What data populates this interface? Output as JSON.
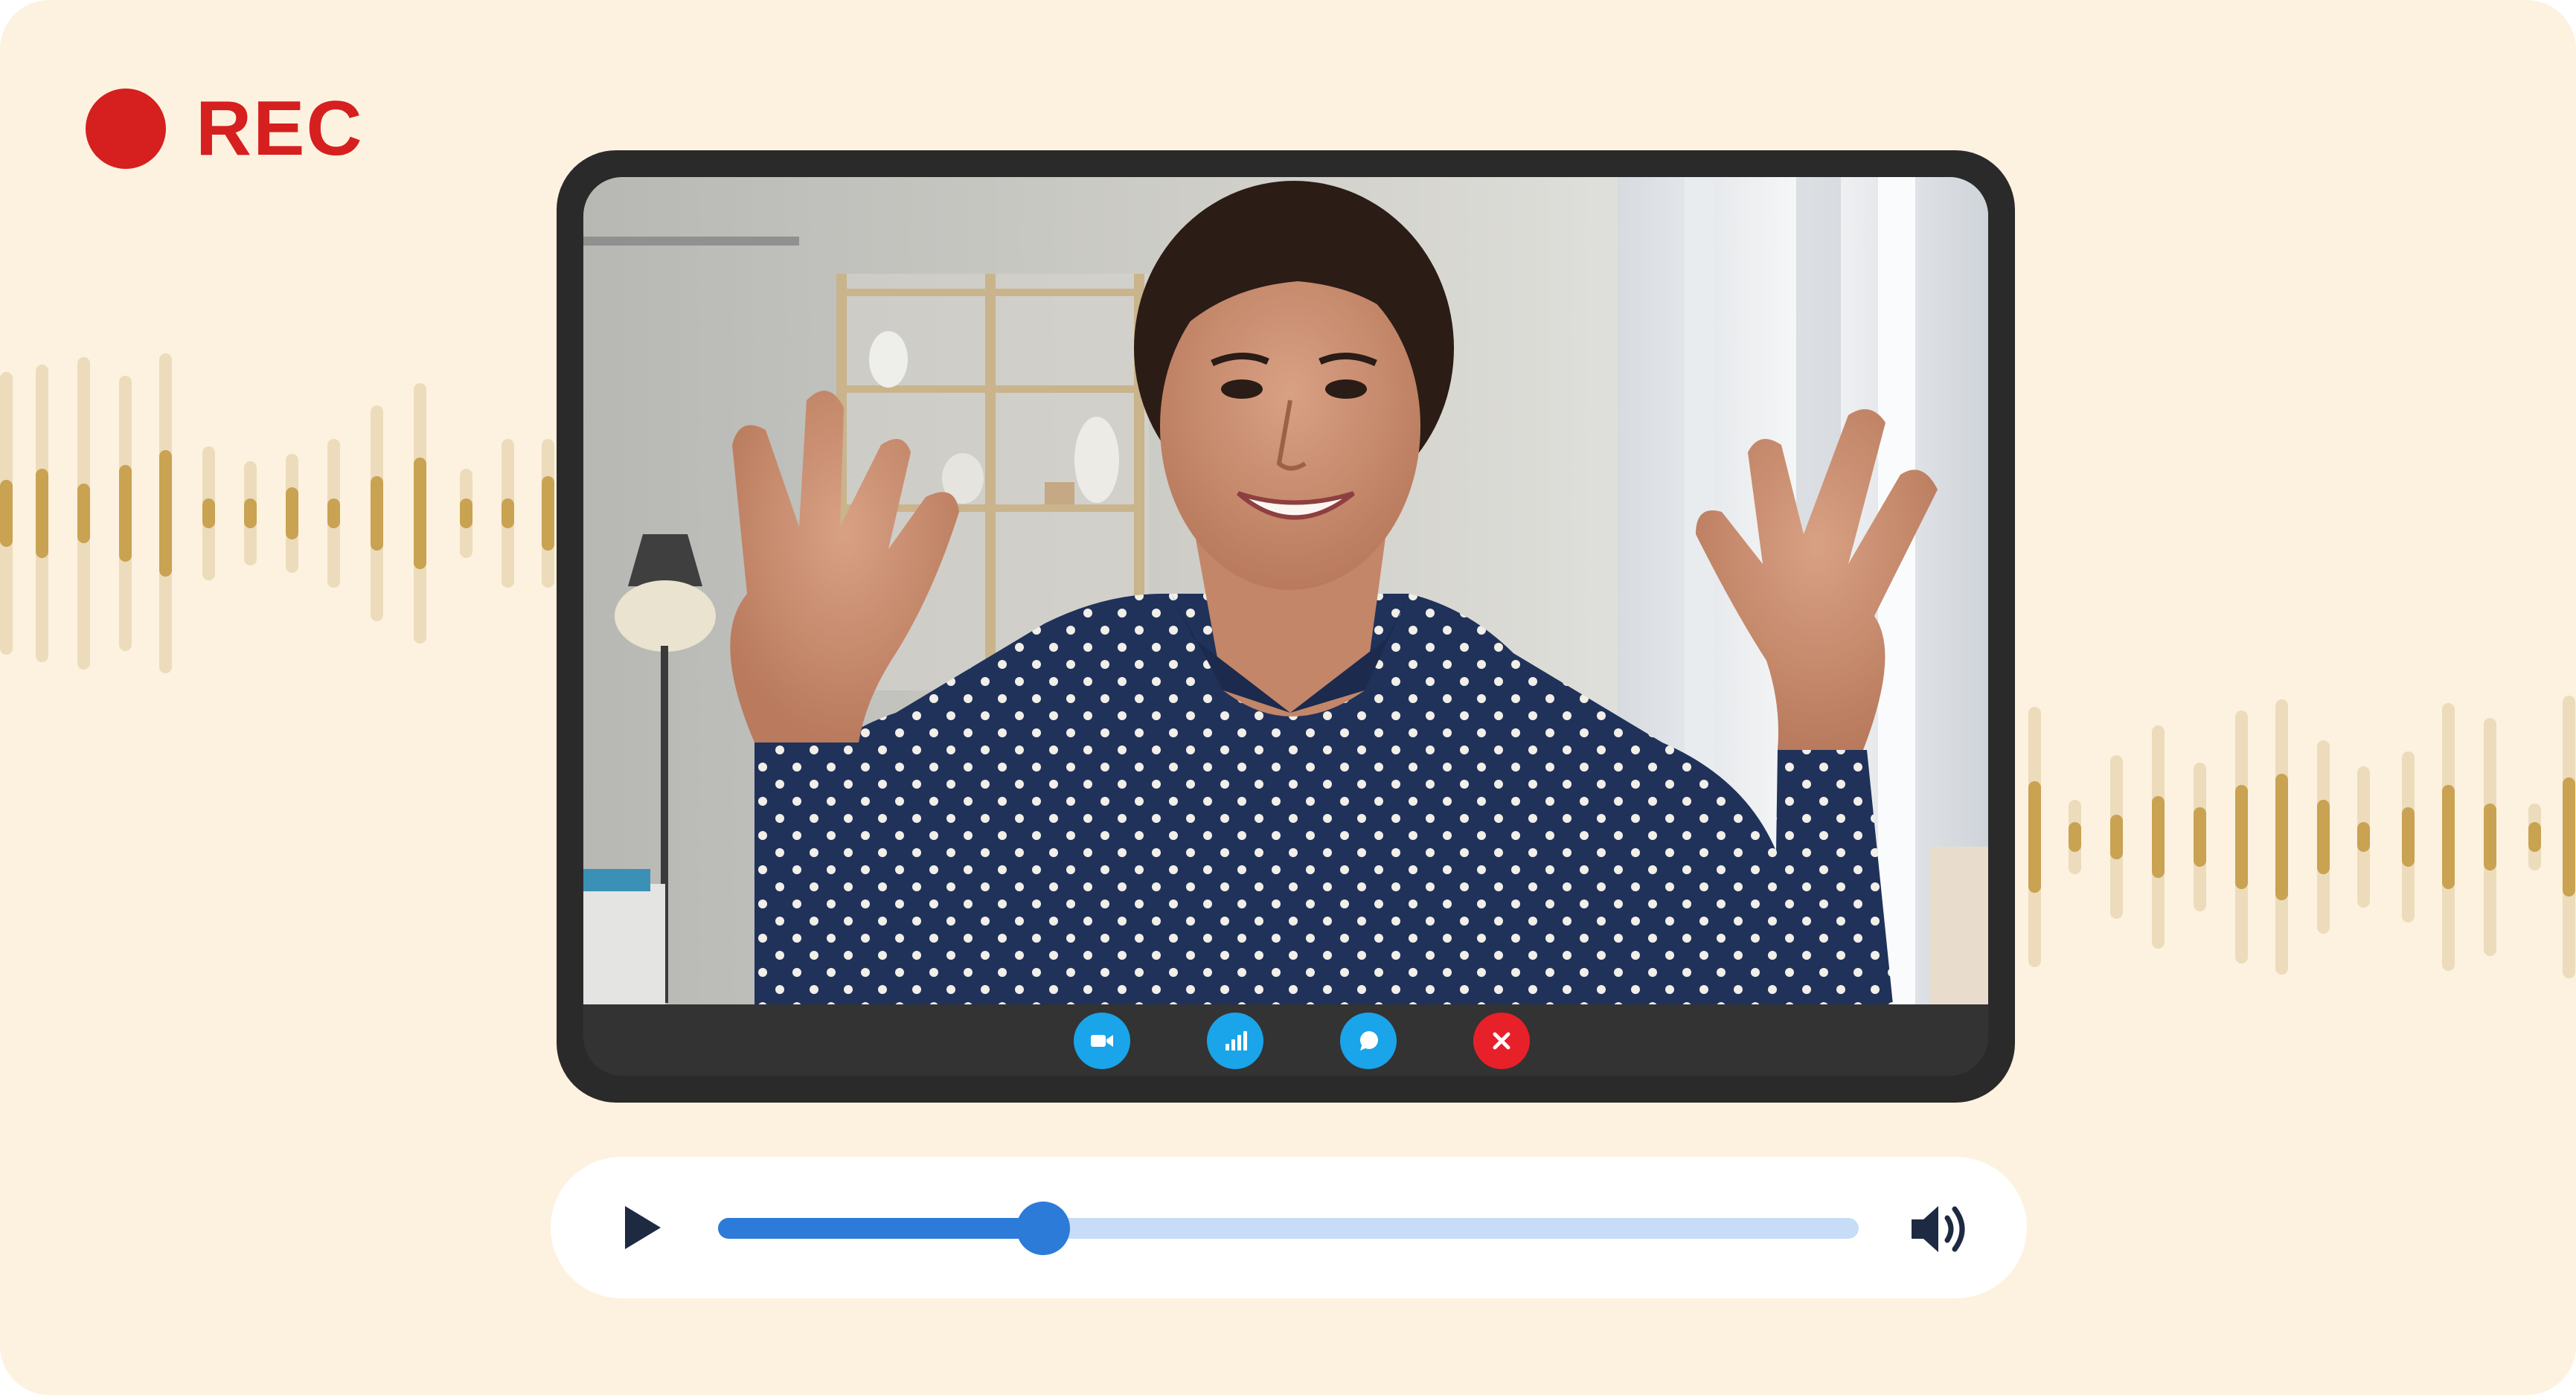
{
  "recording": {
    "label": "REC",
    "dot_color": "#d61f1f",
    "label_color": "#d61f1f"
  },
  "theme": {
    "background": "#fdf2e0",
    "wave_dark": "#c9a252",
    "wave_light": "#ecdcbb",
    "device_frame": "#2a2a2a",
    "call_bar": "#333333"
  },
  "video_call": {
    "controls": [
      {
        "name": "camera-toggle-button",
        "icon": "video-camera-icon",
        "color": "#1aa4ea"
      },
      {
        "name": "signal-stats-button",
        "icon": "signal-bars-icon",
        "color": "#1aa4ea"
      },
      {
        "name": "chat-button",
        "icon": "chat-bubble-icon",
        "color": "#1aa4ea"
      },
      {
        "name": "end-call-button",
        "icon": "close-icon",
        "color": "#e8202a"
      }
    ]
  },
  "player": {
    "progress_fraction": 0.285,
    "track_color": "#c6dcf7",
    "fill_color": "#2c7bd8",
    "play_icon": "play-icon",
    "play_color": "#1e2a42",
    "volume_icon": "volume-icon",
    "volume_color": "#1e2a42"
  }
}
